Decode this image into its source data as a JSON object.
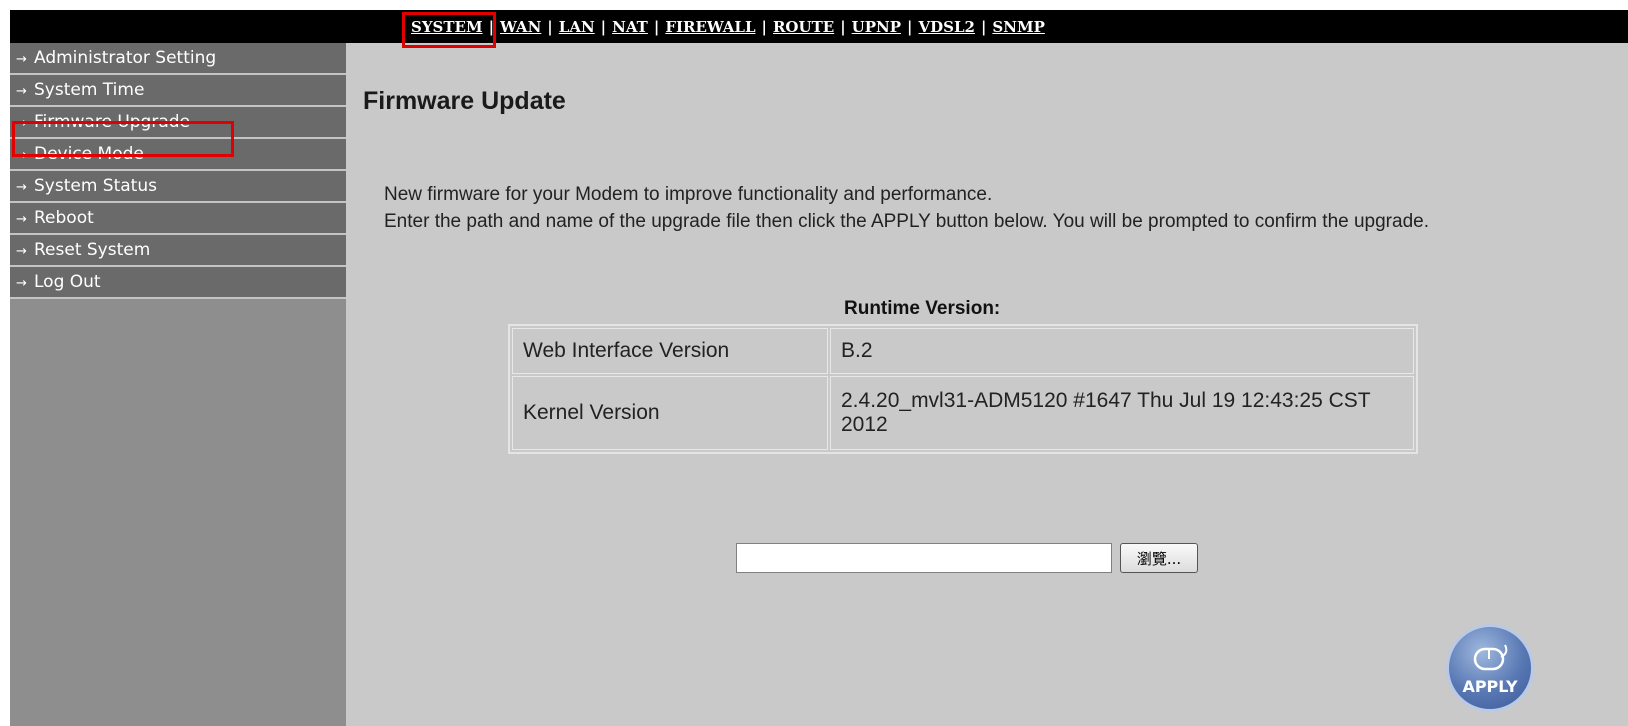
{
  "topnav": {
    "items": [
      "SYSTEM",
      "WAN",
      "LAN",
      "NAT",
      "FIREWALL",
      "ROUTE",
      "UPNP",
      "VDSL2",
      "SNMP"
    ],
    "separator": "|",
    "active": "SYSTEM"
  },
  "sidebar": {
    "arrow": "→",
    "items": [
      {
        "label": "Administrator Setting"
      },
      {
        "label": "System Time"
      },
      {
        "label": "Firmware Upgrade"
      },
      {
        "label": "Device Mode"
      },
      {
        "label": "System Status"
      },
      {
        "label": "Reboot"
      },
      {
        "label": "Reset System"
      },
      {
        "label": "Log Out"
      }
    ],
    "active": "Firmware Upgrade"
  },
  "main": {
    "title": "Firmware Update",
    "description_line1": "New firmware for your Modem to improve functionality and performance.",
    "description_line2": "Enter the path and name of the upgrade file then click the APPLY button below. You will be prompted to confirm the upgrade.",
    "runtime_title": "Runtime Version:",
    "versions": [
      {
        "label": "Web Interface Version",
        "value": "B.2"
      },
      {
        "label": "Kernel Version",
        "value": "2.4.20_mvl31-ADM5120 #1647 Thu Jul 19 12:43:25 CST 2012"
      }
    ],
    "file_input_value": "",
    "browse_label": "瀏覽...",
    "apply_label": "APPLY"
  },
  "colors": {
    "highlight": "#e00000",
    "background": "#c9c9c9",
    "sidebar_item": "#6a6a6a",
    "topbar": "#000000",
    "apply_button": "#5878b4"
  },
  "icons": {
    "sidebar_arrow": "arrow-right-icon",
    "apply": "mouse-icon"
  }
}
